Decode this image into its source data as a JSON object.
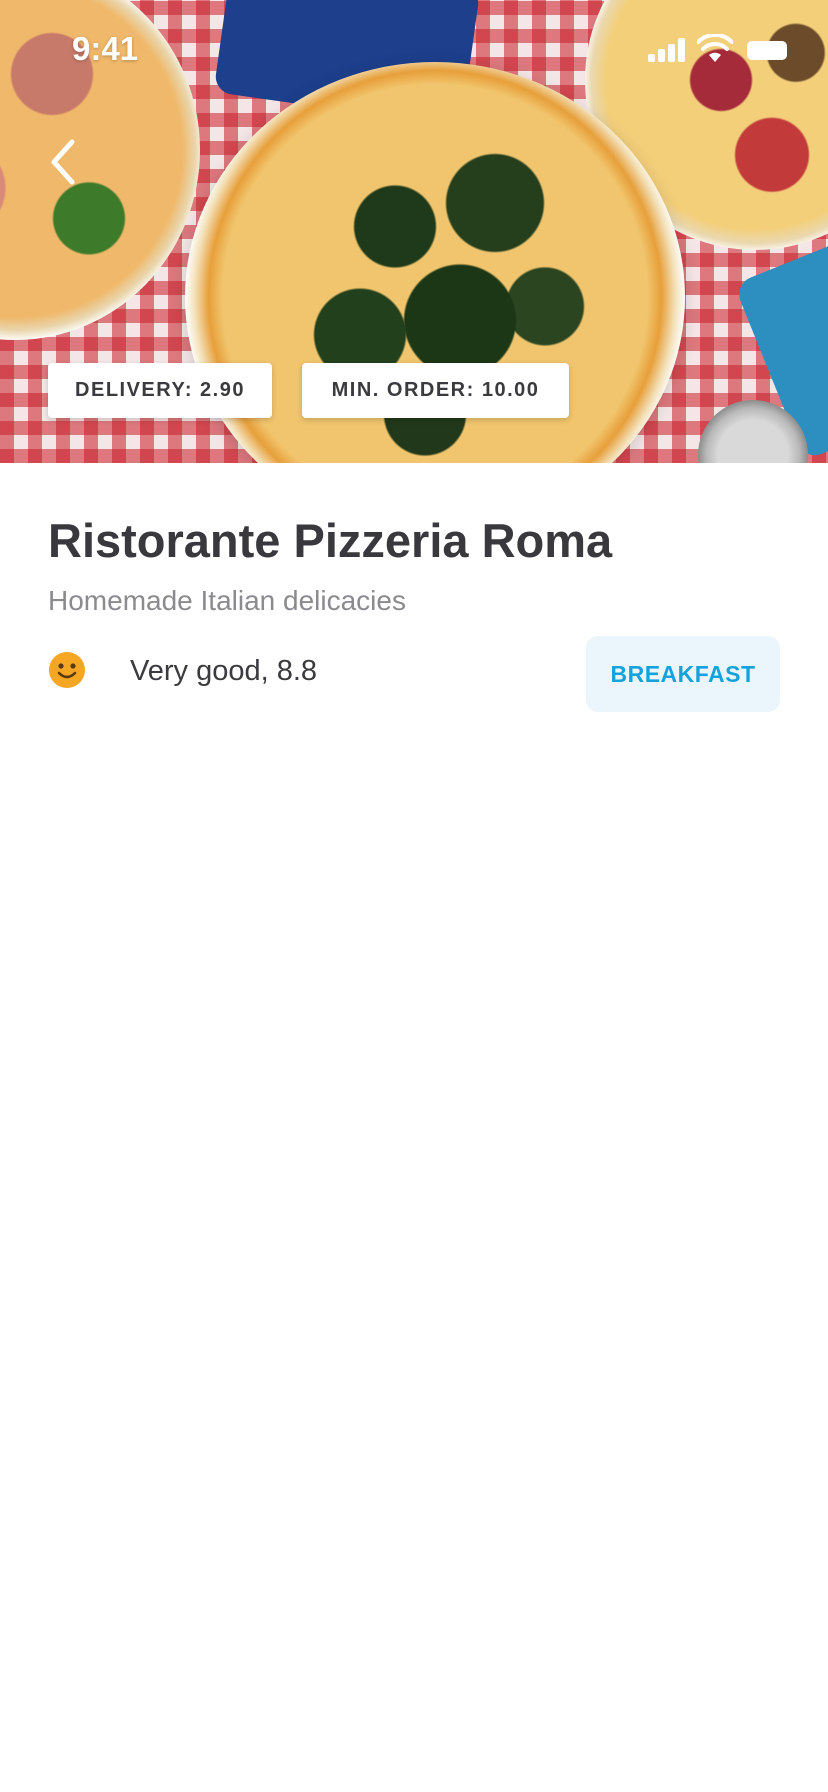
{
  "status_bar": {
    "time": "9:41"
  },
  "hero": {
    "back_icon": "chevron-left-icon",
    "delivery_tag": "DELIVERY: 2.90",
    "min_order_tag": "MIN. ORDER: 10.00"
  },
  "restaurant": {
    "name": "Ristorante Pizzeria Roma",
    "subtitle": "Homemade Italian delicacies",
    "rating_icon": "smiley-face-icon",
    "rating_text": "Very good, 8.8",
    "category_label": "BREAKFAST"
  },
  "colors": {
    "accent": "#16a3dc",
    "category_background": "#eaf6fc",
    "title": "#38383d",
    "subtitle": "#8a8a8f",
    "rating_face": "#f5a623"
  }
}
